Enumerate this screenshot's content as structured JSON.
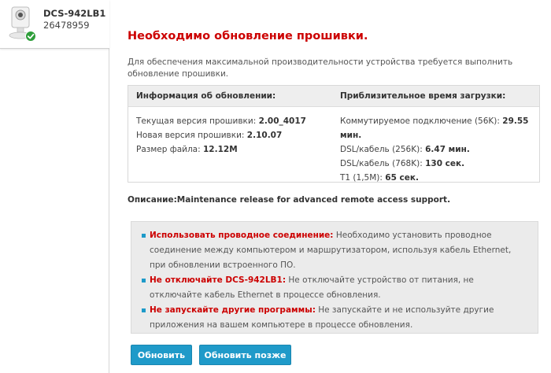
{
  "device": {
    "name": "DCS-942LB1",
    "id": "26478959"
  },
  "page": {
    "title": "Необходимо обновление прошивки.",
    "intro": "Для обеспечения максимальной производительности устройства требуется выполнить обновление прошивки."
  },
  "update_info": {
    "header_left": "Информация об обновлении:",
    "header_right": "Приблизительное время загрузки:",
    "rows_left": [
      {
        "label": "Текущая версия прошивки: ",
        "value": "2.00_4017"
      },
      {
        "label": "Новая версия прошивки: ",
        "value": "2.10.07"
      },
      {
        "label": "Размер файла: ",
        "value": "12.12M"
      }
    ],
    "rows_right": [
      {
        "label": "Коммутируемое подключение (56K): ",
        "value": "29.55"
      },
      {
        "label": "",
        "value": "мин."
      },
      {
        "label": "DSL/кабель (256K): ",
        "value": "6.47 мин."
      },
      {
        "label": "DSL/кабель (768K): ",
        "value": "130 сек."
      },
      {
        "label": "T1 (1,5M): ",
        "value": "65 сек."
      }
    ]
  },
  "description": {
    "label": "Описание:",
    "text": "Maintenance release for advanced remote access support."
  },
  "notes": [
    {
      "lead": "Использовать проводное соединение:",
      "text": " Необходимо установить проводное соединение между компьютером и маршрутизатором, используя кабель Ethernet, при обновлении встроенного ПО."
    },
    {
      "lead": "Не отключайте DCS-942LB1:",
      "text": " Не отключайте устройство от питания, не отключайте кабель Ethernet в процессе обновления."
    },
    {
      "lead": "Не запускайте другие программы:",
      "text": " Не запускайте и не используйте другие приложения на вашем компьютере в процессе обновления."
    }
  ],
  "buttons": {
    "update": "Обновить",
    "later": "Обновить позже"
  },
  "colors": {
    "accent": "#1f9ac9",
    "warning": "#cc0000",
    "status_ok": "#2e9e3a"
  },
  "icons": {
    "camera": "camera-icon",
    "status": "checkmark-icon"
  }
}
